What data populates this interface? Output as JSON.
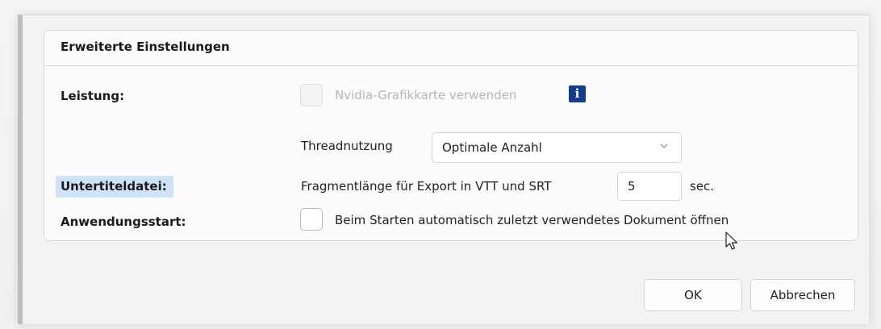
{
  "dialog": {
    "title": "Erweiterte Einstellungen",
    "performance": {
      "label": "Leistung:",
      "gpu_checkbox_label": "Nvidia-Grafikkarte verwenden",
      "gpu_checked": false,
      "info_icon": "info-icon",
      "thread_label": "Threadnutzung",
      "thread_value": "Optimale Anzahl"
    },
    "subtitle": {
      "label": "Untertiteldatei:",
      "fragment_label": "Fragmentlänge für Export in VTT und SRT",
      "fragment_value": "5",
      "fragment_unit": "sec."
    },
    "startup": {
      "label": "Anwendungsstart:",
      "checkbox_label": "Beim Starten automatisch zuletzt verwendetes Dokument öffnen",
      "checked": false
    },
    "buttons": {
      "ok": "OK",
      "cancel": "Abbrechen"
    }
  },
  "colors": {
    "info_icon_bg": "#133d8c",
    "highlight": "#cfe2f7"
  }
}
